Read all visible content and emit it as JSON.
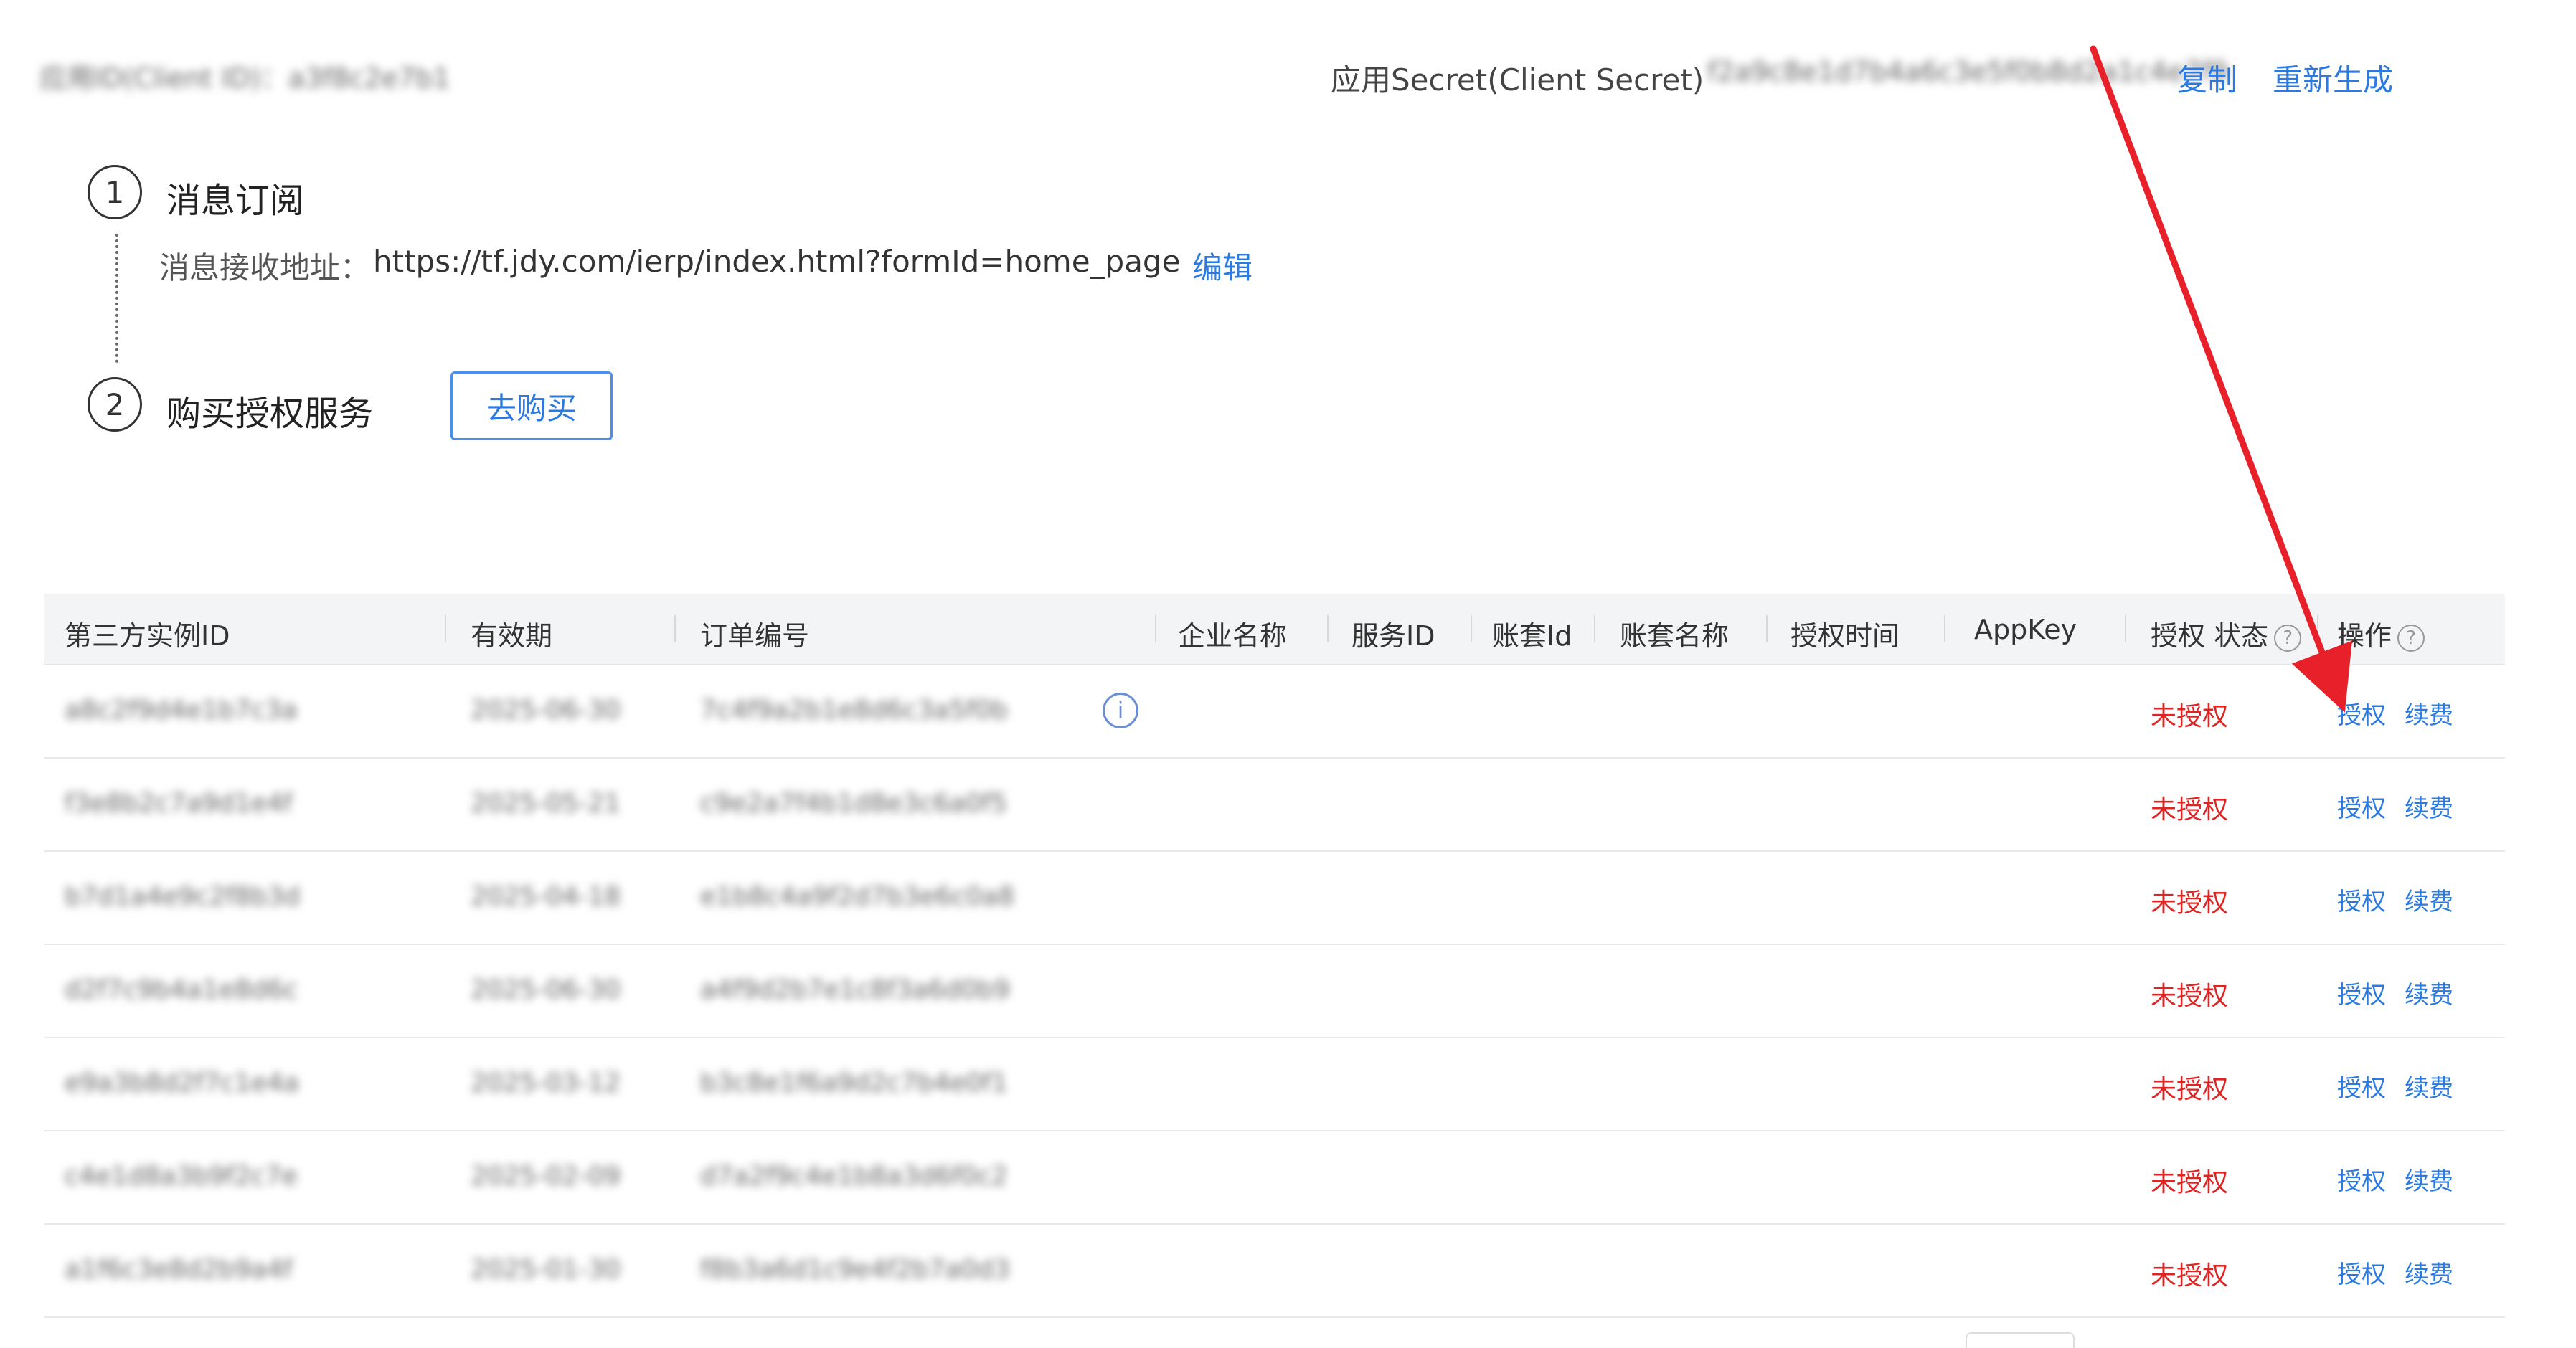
{
  "header": {
    "app_id_value": "应用ID(Client ID)：a3f8c2e7b1",
    "secret_label": "应用Secret(Client Secret)",
    "secret_value": "f2a9c8e1d7b4a6c3e5f0b8d2a1c4e7f9",
    "copy_label": "复制",
    "regen_label": "重新生成"
  },
  "steps": {
    "step1_number": "1",
    "step1_title": "消息订阅",
    "address_label": "消息接收地址：",
    "address_value": "https://tf.jdy.com/ierp/index.html?formId=home_page",
    "edit_label": "编辑",
    "step2_number": "2",
    "step2_title": "购买授权服务",
    "buy_label": "去购买"
  },
  "table": {
    "headers": {
      "instance_id": "第三方实例ID",
      "validity": "有效期",
      "order_no": "订单编号",
      "company": "企业名称",
      "service_id": "服务ID",
      "book_id": "账套Id",
      "book_name": "账套名称",
      "auth_time": "授权时间",
      "appkey": "AppKey",
      "auth_status": "授权 状态",
      "operation": "操作"
    },
    "help_glyph": "?",
    "info_glyph": "i",
    "rows": [
      {
        "instance_id": "a8c2f9d4e1b7c3a",
        "validity": "2025-06-30",
        "order_no": "7c4f9a2b1e8d6c3a5f0b",
        "status": "未授权",
        "auth": "授权",
        "renew": "续费"
      },
      {
        "instance_id": "f3e8b2c7a9d1e4f",
        "validity": "2025-05-21",
        "order_no": "c9e2a7f4b1d8e3c6a0f5",
        "status": "未授权",
        "auth": "授权",
        "renew": "续费"
      },
      {
        "instance_id": "b7d1a4e9c2f8b3d",
        "validity": "2025-04-18",
        "order_no": "e1b8c4a9f2d7b3e6c0a8",
        "status": "未授权",
        "auth": "授权",
        "renew": "续费"
      },
      {
        "instance_id": "d2f7c9b4a1e8d6c",
        "validity": "2025-06-30",
        "order_no": "a4f9d2b7e1c8f3a6d0b9",
        "status": "未授权",
        "auth": "授权",
        "renew": "续费"
      },
      {
        "instance_id": "e9a3b8d2f7c1e4a",
        "validity": "2025-03-12",
        "order_no": "b3c8e1f6a9d2c7b4e0f1",
        "status": "未授权",
        "auth": "授权",
        "renew": "续费"
      },
      {
        "instance_id": "c4e1d8a3b9f2c7e",
        "validity": "2025-02-09",
        "order_no": "d7a2f9c4e1b8a3d6f0c2",
        "status": "未授权",
        "auth": "授权",
        "renew": "续费"
      },
      {
        "instance_id": "a1f6c3e8d2b9a4f",
        "validity": "2025-01-30",
        "order_no": "f8b3a6d1c9e4f2b7a0d3",
        "status": "未授权",
        "auth": "授权",
        "renew": "续费"
      }
    ]
  },
  "annotation": {
    "arrow_color": "#e8202a"
  }
}
